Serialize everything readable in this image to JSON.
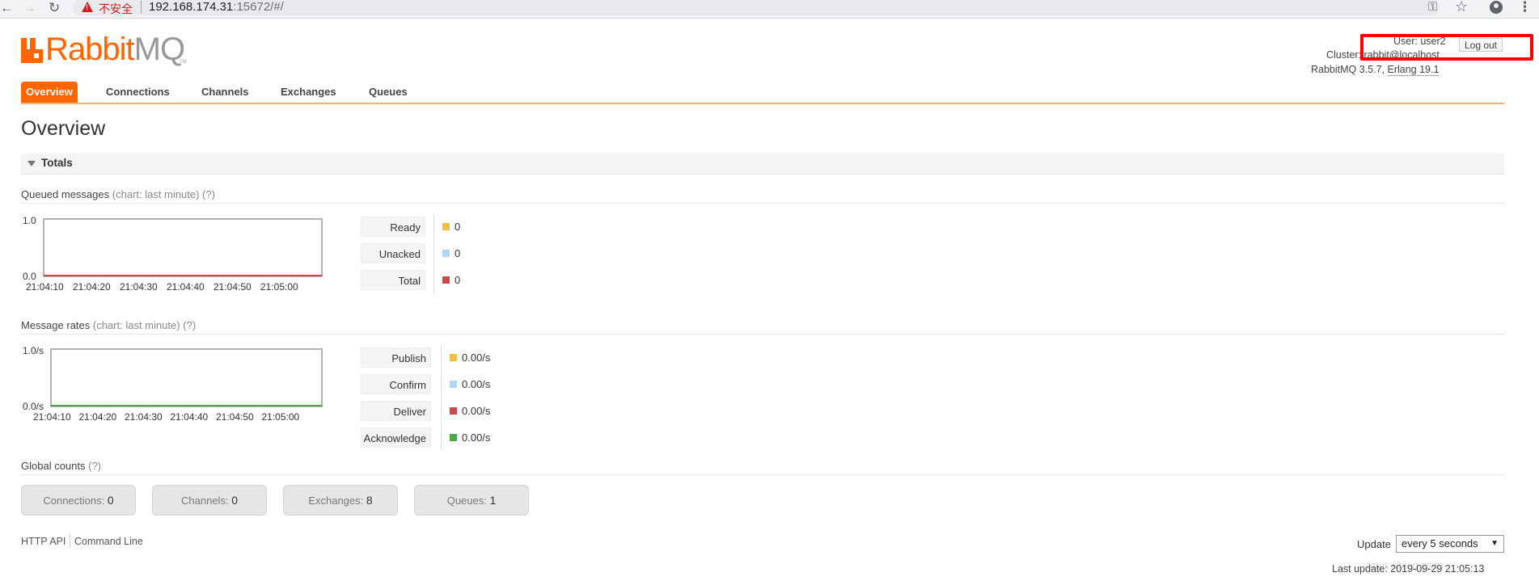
{
  "browser": {
    "insecure_label": "不安全",
    "url_host": "192.168.174.31",
    "url_rest": ":15672/#/"
  },
  "logo": {
    "word_a": "Rabbit",
    "word_b": "MQ",
    "tm": "TM"
  },
  "login": {
    "user_text": "User: user2",
    "logout_label": "Log out",
    "cluster_text": "Cluster: rabbit@localhost",
    "version_prefix": "RabbitMQ 3.5.7, ",
    "erlang_text": "Erlang 19.1"
  },
  "tabs": [
    {
      "label": "Overview",
      "active": true
    },
    {
      "label": "Connections",
      "active": false
    },
    {
      "label": "Channels",
      "active": false
    },
    {
      "label": "Exchanges",
      "active": false
    },
    {
      "label": "Queues",
      "active": false
    }
  ],
  "page_title": "Overview",
  "totals_section": {
    "title": "Totals"
  },
  "queued_messages": {
    "title": "Queued messages",
    "subtitle": "(chart: last minute)",
    "help": "(?)",
    "legend": [
      {
        "label": "Ready",
        "value": "0",
        "color": "#edc240"
      },
      {
        "label": "Unacked",
        "value": "0",
        "color": "#afd8f8"
      },
      {
        "label": "Total",
        "value": "0",
        "color": "#cb4b4b"
      }
    ]
  },
  "message_rates": {
    "title": "Message rates",
    "subtitle": "(chart: last minute)",
    "help": "(?)",
    "legend": [
      {
        "label": "Publish",
        "value": "0.00/s",
        "color": "#edc240"
      },
      {
        "label": "Confirm",
        "value": "0.00/s",
        "color": "#afd8f8"
      },
      {
        "label": "Deliver",
        "value": "0.00/s",
        "color": "#cb4b4b"
      },
      {
        "label": "Acknowledge",
        "value": "0.00/s",
        "color": "#4da74d"
      }
    ]
  },
  "chart_data": [
    {
      "type": "line",
      "title": "Queued messages",
      "x": [
        "21:04:10",
        "21:04:20",
        "21:04:30",
        "21:04:40",
        "21:04:50",
        "21:05:00"
      ],
      "y_ticks": [
        "0.0",
        "1.0"
      ],
      "ylim": [
        0,
        1
      ],
      "series": [
        {
          "name": "Ready",
          "values": [
            0,
            0,
            0,
            0,
            0,
            0
          ],
          "color": "#edc240"
        },
        {
          "name": "Unacked",
          "values": [
            0,
            0,
            0,
            0,
            0,
            0
          ],
          "color": "#afd8f8"
        },
        {
          "name": "Total",
          "values": [
            0,
            0,
            0,
            0,
            0,
            0
          ],
          "color": "#cb4b4b"
        }
      ]
    },
    {
      "type": "line",
      "title": "Message rates",
      "x": [
        "21:04:10",
        "21:04:20",
        "21:04:30",
        "21:04:40",
        "21:04:50",
        "21:05:00"
      ],
      "y_ticks": [
        "0.0/s",
        "1.0/s"
      ],
      "ylim": [
        0,
        1
      ],
      "series": [
        {
          "name": "Publish",
          "values": [
            0,
            0,
            0,
            0,
            0,
            0
          ],
          "color": "#edc240"
        },
        {
          "name": "Confirm",
          "values": [
            0,
            0,
            0,
            0,
            0,
            0
          ],
          "color": "#afd8f8"
        },
        {
          "name": "Deliver",
          "values": [
            0,
            0,
            0,
            0,
            0,
            0
          ],
          "color": "#cb4b4b"
        },
        {
          "name": "Acknowledge",
          "values": [
            0,
            0,
            0,
            0,
            0,
            0
          ],
          "color": "#4da74d"
        }
      ]
    }
  ],
  "global_counts": {
    "title": "Global counts",
    "help": "(?)",
    "items": [
      {
        "label": "Connections:",
        "value": "0"
      },
      {
        "label": "Channels:",
        "value": "0"
      },
      {
        "label": "Exchanges:",
        "value": "8"
      },
      {
        "label": "Queues:",
        "value": "1"
      }
    ]
  },
  "footer": {
    "http_api": "HTTP API",
    "command_line": "Command Line",
    "update_label": "Update",
    "update_value": "every 5 seconds",
    "last_update": "Last update: 2019-09-29 21:05:13",
    "watermark": "https://blog.csdn"
  },
  "icons": {
    "back": "arrow-left-icon",
    "forward": "arrow-right-icon",
    "reload": "reload-icon",
    "warning": "warning-icon",
    "key": "key-icon",
    "star": "star-icon",
    "profile": "profile-icon",
    "menu": "kebab-menu-icon"
  },
  "colors": {
    "brand": "#ff6600",
    "highlight": "#ff0000"
  }
}
